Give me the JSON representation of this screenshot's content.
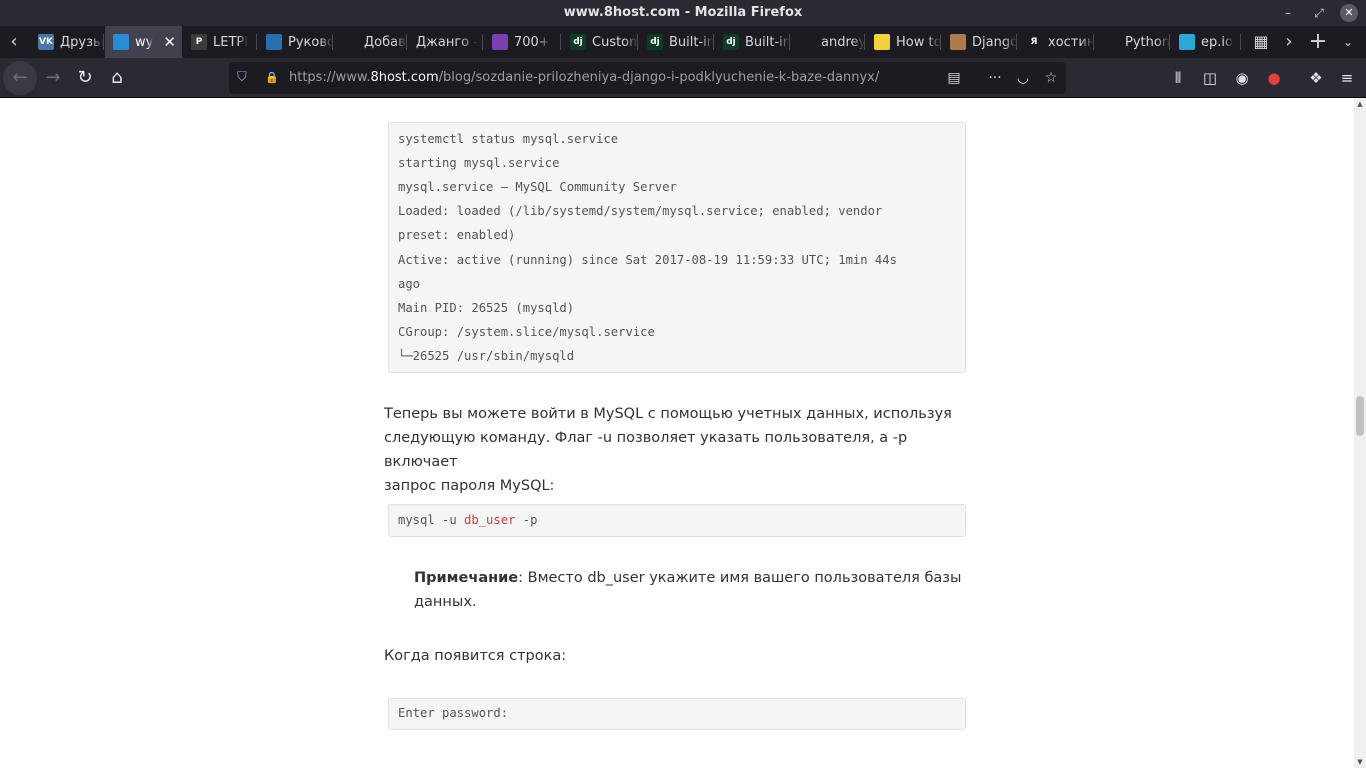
{
  "window": {
    "title": "www.8host.com - Mozilla Firefox"
  },
  "tabs": [
    {
      "label": "Друзья",
      "icon": "vk-icon",
      "color": "#4a76a8",
      "glyph": "VK"
    },
    {
      "label": "wy",
      "icon": "site-icon",
      "color": "#2a8bd6",
      "glyph": "",
      "active": true
    },
    {
      "label": "LETPI",
      "icon": "letpi-icon",
      "color": "#3b3b3b",
      "glyph": "P"
    },
    {
      "label": "Руководство",
      "icon": "graduation-icon",
      "color": "#2a6fb0",
      "glyph": ""
    },
    {
      "label": "Добавление",
      "icon": "book-icon",
      "color": "#1c1b22",
      "glyph": ""
    },
    {
      "label": "Джанго -",
      "icon": "none",
      "color": "",
      "glyph": ""
    },
    {
      "label": "700+",
      "icon": "colorlib-icon",
      "color": "#7c3fb0",
      "glyph": ""
    },
    {
      "label": "Custom",
      "icon": "django-icon",
      "color": "#0c3c26",
      "glyph": "dj"
    },
    {
      "label": "Built-in",
      "icon": "django-icon",
      "color": "#0c3c26",
      "glyph": "dj"
    },
    {
      "label": "Built-in",
      "icon": "django-icon",
      "color": "#0c3c26",
      "glyph": "dj"
    },
    {
      "label": "andrey",
      "icon": "github-icon",
      "color": "#1c1b22",
      "glyph": ""
    },
    {
      "label": "How to",
      "icon": "python-icon",
      "color": "#f4d03f",
      "glyph": ""
    },
    {
      "label": "Django",
      "icon": "avatar-icon",
      "color": "#b07a50",
      "glyph": ""
    },
    {
      "label": "хостинг",
      "icon": "yandex-icon",
      "color": "#1c1b22",
      "glyph": "Я"
    },
    {
      "label": "Python",
      "icon": "gcloud-icon",
      "color": "#1c1b22",
      "glyph": ""
    },
    {
      "label": "ep.io",
      "icon": "epio-icon",
      "color": "#2aa8d8",
      "glyph": ""
    }
  ],
  "nav": {
    "url_prefix": "https://www.",
    "url_host": "8host.com",
    "url_path": "/blog/sozdanie-prilozheniya-django-i-podklyuchenie-k-baze-dannyx/"
  },
  "content": {
    "code1": [
      "systemctl status mysql.service",
      "starting mysql.service",
      "mysql.service – MySQL Community Server",
      "Loaded: loaded (/lib/systemd/system/mysql.service; enabled; vendor",
      "preset: enabled)",
      "Active: active (running) since Sat 2017-08-19 11:59:33 UTC; 1min 44s",
      "ago",
      "Main PID: 26525 (mysqld)",
      "CGroup: /system.slice/mysql.service",
      "└─26525 /usr/sbin/mysqld"
    ],
    "para1": [
      "Теперь вы можете войти в MySQL с помощью учетных данных, используя",
      "следующую команду. Флаг -u позволяет указать пользователя, а -p включает",
      "запрос пароля MySQL:"
    ],
    "code2": {
      "pre": "mysql -u ",
      "highlight": "db_user",
      "post": " -p"
    },
    "note": {
      "bold": "Примечание",
      "line1": ": Вместо db_user укажите имя вашего пользователя базы",
      "line2": "данных."
    },
    "para2": "Когда появится строка:",
    "code3": "Enter password:"
  }
}
